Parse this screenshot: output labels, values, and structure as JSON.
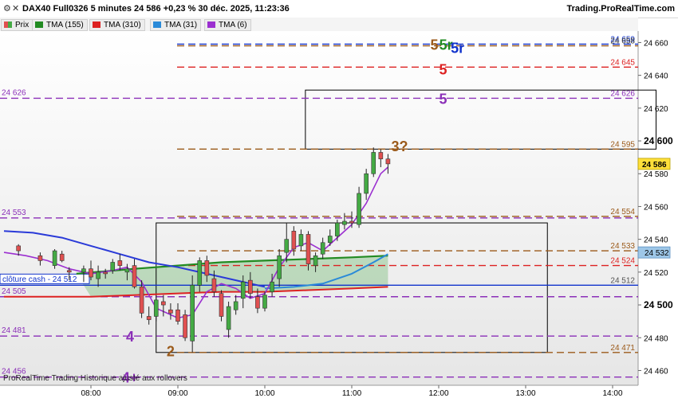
{
  "header": {
    "title": "DAX40 Full0326 5 minutes 24 586 +0,23 % 30 déc. 2025, 11:23:36",
    "brand": "Trading.ProRealTime.com",
    "icons": [
      "options-icon",
      "close-icon"
    ]
  },
  "legend": [
    {
      "label": "Prix",
      "color": "#44aa44"
    },
    {
      "label": "TMA (155)",
      "color": "#228b22"
    },
    {
      "label": "TMA (310)",
      "color": "#dd2222"
    },
    {
      "label": "TMA (31)",
      "color": "#2a8ad8"
    },
    {
      "label": "TMA (6)",
      "color": "#8a2be2"
    }
  ],
  "footer": "ProRealTime Trading  Historique ajusté aux rollovers",
  "chart_data": {
    "type": "candlestick",
    "x_ticks": [
      "08:00",
      "09:00",
      "10:00",
      "11:00",
      "12:00",
      "13:00",
      "14:00"
    ],
    "ylim": [
      24451,
      24667
    ],
    "y_ticks": [
      24460,
      24480,
      24500,
      24520,
      24540,
      24560,
      24580,
      24600,
      24620,
      24640,
      24660
    ],
    "y_ticks_bold": [
      24500,
      24600
    ],
    "price_tag": {
      "label": "24 586",
      "value": 24586
    },
    "tag_24532": {
      "label": "24 532",
      "value": 24532
    },
    "candles": [
      {
        "t": "07:10",
        "o": 24536,
        "h": 24537,
        "l": 24530,
        "c": 24533
      },
      {
        "t": "07:25",
        "o": 24530,
        "h": 24532,
        "l": 24524,
        "c": 24527
      },
      {
        "t": "07:35",
        "o": 24524,
        "h": 24534,
        "l": 24522,
        "c": 24533
      },
      {
        "t": "07:40",
        "o": 24531,
        "h": 24533,
        "l": 24526,
        "c": 24527
      },
      {
        "t": "07:45",
        "o": 24521,
        "h": 24523,
        "l": 24515,
        "c": 24520
      },
      {
        "t": "07:55",
        "o": 24520,
        "h": 24524,
        "l": 24514,
        "c": 24522
      },
      {
        "t": "08:00",
        "o": 24522,
        "h": 24527,
        "l": 24515,
        "c": 24517
      },
      {
        "t": "08:05",
        "o": 24516,
        "h": 24524,
        "l": 24511,
        "c": 24520
      },
      {
        "t": "08:10",
        "o": 24520,
        "h": 24522,
        "l": 24516,
        "c": 24519
      },
      {
        "t": "08:15",
        "o": 24521,
        "h": 24528,
        "l": 24519,
        "c": 24526
      },
      {
        "t": "08:20",
        "o": 24527,
        "h": 24531,
        "l": 24521,
        "c": 24524
      },
      {
        "t": "08:25",
        "o": 24520,
        "h": 24525,
        "l": 24515,
        "c": 24522
      },
      {
        "t": "08:30",
        "o": 24524,
        "h": 24528,
        "l": 24510,
        "c": 24511
      },
      {
        "t": "08:35",
        "o": 24511,
        "h": 24515,
        "l": 24492,
        "c": 24495
      },
      {
        "t": "08:40",
        "o": 24493,
        "h": 24499,
        "l": 24488,
        "c": 24491
      },
      {
        "t": "08:45",
        "o": 24493,
        "h": 24506,
        "l": 24490,
        "c": 24503
      },
      {
        "t": "08:50",
        "o": 24502,
        "h": 24506,
        "l": 24493,
        "c": 24500
      },
      {
        "t": "08:55",
        "o": 24497,
        "h": 24501,
        "l": 24491,
        "c": 24495
      },
      {
        "t": "09:00",
        "o": 24497,
        "h": 24501,
        "l": 24488,
        "c": 24490
      },
      {
        "t": "09:05",
        "o": 24494,
        "h": 24497,
        "l": 24478,
        "c": 24480
      },
      {
        "t": "09:10",
        "o": 24478,
        "h": 24518,
        "l": 24471,
        "c": 24512
      },
      {
        "t": "09:15",
        "o": 24512,
        "h": 24529,
        "l": 24508,
        "c": 24527
      },
      {
        "t": "09:20",
        "o": 24527,
        "h": 24530,
        "l": 24514,
        "c": 24518
      },
      {
        "t": "09:25",
        "o": 24516,
        "h": 24521,
        "l": 24505,
        "c": 24508
      },
      {
        "t": "09:30",
        "o": 24507,
        "h": 24509,
        "l": 24490,
        "c": 24493
      },
      {
        "t": "09:35",
        "o": 24485,
        "h": 24502,
        "l": 24480,
        "c": 24499
      },
      {
        "t": "09:40",
        "o": 24497,
        "h": 24506,
        "l": 24494,
        "c": 24502
      },
      {
        "t": "09:45",
        "o": 24504,
        "h": 24518,
        "l": 24498,
        "c": 24514
      },
      {
        "t": "09:50",
        "o": 24515,
        "h": 24520,
        "l": 24504,
        "c": 24507
      },
      {
        "t": "09:55",
        "o": 24505,
        "h": 24510,
        "l": 24495,
        "c": 24498
      },
      {
        "t": "10:00",
        "o": 24498,
        "h": 24508,
        "l": 24496,
        "c": 24506
      },
      {
        "t": "10:05",
        "o": 24508,
        "h": 24519,
        "l": 24505,
        "c": 24514
      },
      {
        "t": "10:10",
        "o": 24516,
        "h": 24534,
        "l": 24511,
        "c": 24530
      },
      {
        "t": "10:15",
        "o": 24532,
        "h": 24550,
        "l": 24526,
        "c": 24540
      },
      {
        "t": "10:20",
        "o": 24545,
        "h": 24548,
        "l": 24530,
        "c": 24534
      },
      {
        "t": "10:25",
        "o": 24536,
        "h": 24546,
        "l": 24533,
        "c": 24543
      },
      {
        "t": "10:30",
        "o": 24543,
        "h": 24545,
        "l": 24521,
        "c": 24525
      },
      {
        "t": "10:35",
        "o": 24524,
        "h": 24532,
        "l": 24520,
        "c": 24530
      },
      {
        "t": "10:40",
        "o": 24531,
        "h": 24541,
        "l": 24528,
        "c": 24538
      },
      {
        "t": "10:45",
        "o": 24538,
        "h": 24546,
        "l": 24536,
        "c": 24542
      },
      {
        "t": "10:50",
        "o": 24542,
        "h": 24552,
        "l": 24539,
        "c": 24550
      },
      {
        "t": "10:55",
        "o": 24549,
        "h": 24556,
        "l": 24546,
        "c": 24551
      },
      {
        "t": "11:00",
        "o": 24551,
        "h": 24557,
        "l": 24547,
        "c": 24550
      },
      {
        "t": "11:05",
        "o": 24549,
        "h": 24572,
        "l": 24547,
        "c": 24568
      },
      {
        "t": "11:10",
        "o": 24568,
        "h": 24583,
        "l": 24564,
        "c": 24580
      },
      {
        "t": "11:15",
        "o": 24580,
        "h": 24596,
        "l": 24578,
        "c": 24593
      },
      {
        "t": "11:20",
        "o": 24593,
        "h": 24595,
        "l": 24584,
        "c": 24589
      },
      {
        "t": "11:25",
        "o": 24589,
        "h": 24592,
        "l": 24580,
        "c": 24586
      }
    ],
    "tma_lines": [
      {
        "name": "TMA (155)",
        "color": "#228b22",
        "points": [
          [
            "07:50",
            24519
          ],
          [
            "08:30",
            24522
          ],
          [
            "09:00",
            24524
          ],
          [
            "09:30",
            24526
          ],
          [
            "10:00",
            24527
          ],
          [
            "10:30",
            24528
          ],
          [
            "11:00",
            24529
          ],
          [
            "11:25",
            24530
          ]
        ]
      },
      {
        "name": "TMA (310)",
        "color": "#dd2222",
        "points": [
          [
            "07:00",
            24505
          ],
          [
            "08:00",
            24505
          ],
          [
            "08:30",
            24506
          ],
          [
            "09:00",
            24507
          ],
          [
            "09:30",
            24508
          ],
          [
            "10:00",
            24508
          ],
          [
            "10:30",
            24509
          ],
          [
            "11:00",
            24510
          ],
          [
            "11:25",
            24511
          ]
        ]
      },
      {
        "name": "TMA (31)",
        "color": "#2a8ad8",
        "points": [
          [
            "10:00",
            24510
          ],
          [
            "10:20",
            24511
          ],
          [
            "10:40",
            24513
          ],
          [
            "11:00",
            24519
          ],
          [
            "11:15",
            24526
          ],
          [
            "11:25",
            24531
          ]
        ]
      },
      {
        "name": "TMA (31) blue",
        "color": "#2a3ad8",
        "points": [
          [
            "07:00",
            24545
          ],
          [
            "07:20",
            24544
          ],
          [
            "07:40",
            24541
          ],
          [
            "08:00",
            24536
          ],
          [
            "08:20",
            24531
          ],
          [
            "08:40",
            24526
          ],
          [
            "09:00",
            24523
          ],
          [
            "09:20",
            24519
          ],
          [
            "09:40",
            24515
          ],
          [
            "10:00",
            24511
          ]
        ]
      },
      {
        "name": "TMA (6)",
        "color": "#9b2fd0",
        "points": [
          [
            "07:00",
            24532
          ],
          [
            "07:15",
            24530
          ],
          [
            "07:30",
            24527
          ],
          [
            "07:45",
            24522
          ],
          [
            "08:00",
            24519
          ],
          [
            "08:15",
            24521
          ],
          [
            "08:25",
            24523
          ],
          [
            "08:35",
            24514
          ],
          [
            "08:45",
            24498
          ],
          [
            "09:00",
            24492
          ],
          [
            "09:10",
            24494
          ],
          [
            "09:20",
            24508
          ],
          [
            "09:30",
            24513
          ],
          [
            "09:40",
            24510
          ],
          [
            "09:50",
            24504
          ],
          [
            "10:00",
            24507
          ],
          [
            "10:10",
            24523
          ],
          [
            "10:20",
            24535
          ],
          [
            "10:30",
            24538
          ],
          [
            "10:40",
            24533
          ],
          [
            "10:50",
            24541
          ],
          [
            "11:00",
            24549
          ],
          [
            "11:10",
            24562
          ],
          [
            "11:20",
            24580
          ],
          [
            "11:25",
            24584
          ]
        ]
      }
    ],
    "h_lines": [
      {
        "value": 24659,
        "color": "#1133cc",
        "dash": true,
        "label": "24 659",
        "label_color": "#1133cc"
      },
      {
        "value": 24658,
        "color": "#9b5a1a",
        "dash": true,
        "label": "24 658",
        "label_color": "#333333"
      },
      {
        "value": 24645,
        "color": "#dd2222",
        "dash": true,
        "label": "24 645",
        "label_color": "#dd2222"
      },
      {
        "value": 24626,
        "color": "#8b2fb8",
        "dash": true,
        "label": "24 626",
        "label_color": "#8b2fb8",
        "left_label": "24 626"
      },
      {
        "value": 24595,
        "color": "#9b5a1a",
        "dash": true,
        "label": "24 595",
        "label_color": "#9b5a1a"
      },
      {
        "value": 24554,
        "color": "#9b5a1a",
        "dash": true,
        "label": "24 554",
        "label_color": "#9b5a1a"
      },
      {
        "value": 24553,
        "color": "#8b2fb8",
        "dash": true,
        "label": "",
        "label_color": "#8b2fb8",
        "left_label": "24 553"
      },
      {
        "value": 24533,
        "color": "#9b5a1a",
        "dash": true,
        "label": "24 533",
        "label_color": "#9b5a1a"
      },
      {
        "value": 24524,
        "color": "#dd2222",
        "dash": true,
        "label": "24 524",
        "label_color": "#dd2222"
      },
      {
        "value": 24512,
        "color": "#1133cc",
        "dash": false,
        "label": "24 512",
        "label_color": "#555555"
      },
      {
        "value": 24505,
        "color": "#8b2fb8",
        "dash": true,
        "label": "",
        "label_color": "#8b2fb8",
        "left_label": "24 505"
      },
      {
        "value": 24481,
        "color": "#8b2fb8",
        "dash": true,
        "label": "",
        "label_color": "#8b2fb8",
        "left_label": "24 481"
      },
      {
        "value": 24471,
        "color": "#9b5a1a",
        "dash": true,
        "label": "24 471",
        "label_color": "#9b5a1a"
      },
      {
        "value": 24456,
        "color": "#8b2fb8",
        "dash": true,
        "label": "",
        "label_color": "#8b2fb8",
        "left_label": "24 456"
      }
    ],
    "cloture_label": "clôture cash -  24 512",
    "annotations": [
      {
        "text": "5",
        "color": "#9b5a1a",
        "t": "11:57",
        "v": 24659
      },
      {
        "text": "5r",
        "color": "#228b22",
        "t": "12:05",
        "v": 24659
      },
      {
        "text": "5r",
        "color": "#1133cc",
        "t": "12:13",
        "v": 24657
      },
      {
        "text": "5",
        "color": "#dd2222",
        "t": "12:03",
        "v": 24644
      },
      {
        "text": "5",
        "color": "#8b2fb8",
        "t": "12:03",
        "v": 24626
      },
      {
        "text": "3?",
        "color": "#9b5a1a",
        "t": "11:33",
        "v": 24597
      },
      {
        "text": "4",
        "color": "#8b2fb8",
        "t": "08:27",
        "v": 24481
      },
      {
        "text": "2",
        "color": "#9b5a1a",
        "t": "08:55",
        "v": 24472
      },
      {
        "text": "4+",
        "color": "#8b2fb8",
        "t": "08:27",
        "v": 24456
      }
    ],
    "boxes": [
      {
        "t1": "10:28",
        "t2": "14:30",
        "v1": 24631,
        "v2": 24595
      },
      {
        "t1": "08:45",
        "t2": "13:15",
        "v1": 24550,
        "v2": 24471
      }
    ]
  }
}
